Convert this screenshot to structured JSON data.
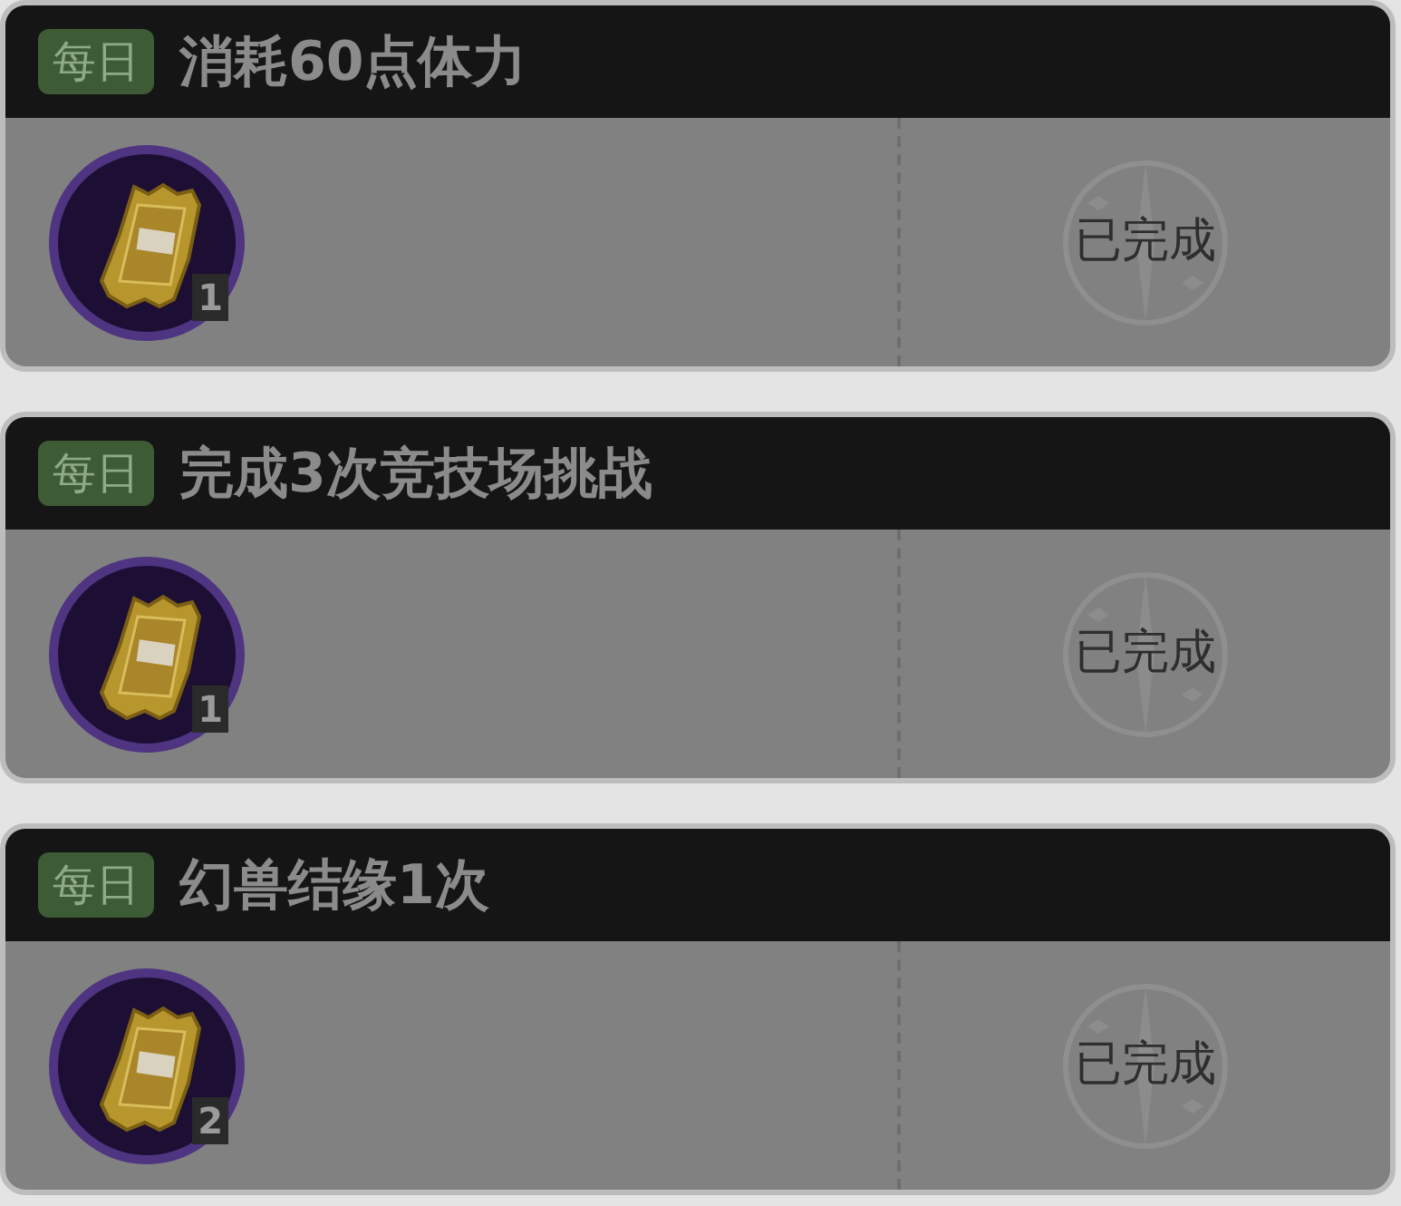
{
  "tasks": [
    {
      "tag": "每日",
      "title": "消耗60点体力",
      "reward_count": "1",
      "status": "已完成"
    },
    {
      "tag": "每日",
      "title": "完成3次竞技场挑战",
      "reward_count": "1",
      "status": "已完成"
    },
    {
      "tag": "每日",
      "title": "幻兽结缘1次",
      "reward_count": "2",
      "status": "已完成"
    }
  ]
}
